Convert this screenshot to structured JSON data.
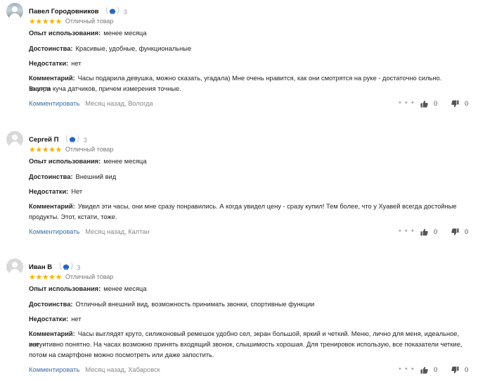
{
  "reviews": [
    {
      "author": "Павел Городовников",
      "badge_count": "3",
      "rating_text": "Отличный товар",
      "usage_label": "Опыт использования:",
      "usage": "менее месяца",
      "pros_label": "Достоинства:",
      "pros": "Красивые, удобные, функциональные",
      "cons_label": "Недостатки:",
      "cons": "нет",
      "comment_label": "Комментарий:",
      "comment_line1": "Часы подарила девушка, можно сказать, угадала) Мне очень нравится, как они смотрятся на руке - достаточно сильно. Внутри",
      "comment_line2": "зашита куча датчиков, причем измерения точные.",
      "comment_line3": "",
      "reply_label": "Комментировать",
      "meta": "Месяц назад, Вологда",
      "likes": "0",
      "dislikes": "0"
    },
    {
      "author": "Сергей П",
      "badge_count": "3",
      "rating_text": "Отличный товар",
      "usage_label": "Опыт использования:",
      "usage": "менее месяца",
      "pros_label": "Достоинства:",
      "pros": "Внешний вид",
      "cons_label": "Недостатки:",
      "cons": "Нет",
      "comment_label": "Комментарий:",
      "comment_line1": "Увидел эти часы, они мне сразу понравились. А когда увидел цену - сразу купил! Тем более, что у Хуавей всегда достойные",
      "comment_line2": "продукты. Этот, кстати, тоже.",
      "comment_line3": "",
      "reply_label": "Комментировать",
      "meta": "Месяц назад, Калтан",
      "likes": "0",
      "dislikes": "0"
    },
    {
      "author": "Иван В",
      "badge_count": "3",
      "rating_text": "Отличный товар",
      "usage_label": "Опыт использования:",
      "usage": "менее месяца",
      "pros_label": "Достоинства:",
      "pros": "Отличный внешний вид, возможность принимать звонки, спортивные функции",
      "cons_label": "Недостатки:",
      "cons": "нет",
      "comment_label": "Комментарий:",
      "comment_line1": "Часы выглядят круто, силиконовый ремешок удобно сел, экран большой, яркий и четкий. Меню, лично для меня, идеальное, все",
      "comment_line2": "интуитивно понятно. На часах возможно принять входящий звонок, слышимость хорошая. Для тренировок использую, все показатели четкие,",
      "comment_line3": "потом на смартфоне можно посмотреть или даже запостить.",
      "reply_label": "Комментировать",
      "meta": "Месяц назад, Хабаровск",
      "likes": "0",
      "dislikes": "0"
    }
  ],
  "colors": {
    "star": "#f8b300",
    "link": "#3b6ea8",
    "muted": "#888888"
  },
  "icons": {
    "badge": "achievement-badge-icon",
    "like": "thumbs-up-icon",
    "dislike": "thumbs-down-icon",
    "more": "more-dots-icon"
  }
}
